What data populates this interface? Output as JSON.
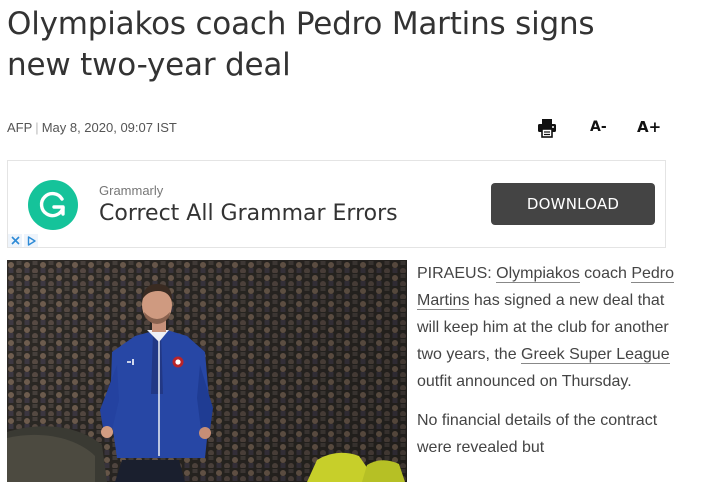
{
  "article": {
    "headline": "Olympiakos coach Pedro Martins signs new two-year deal",
    "source": "AFP",
    "date": "May 8, 2020, 09:07 IST"
  },
  "tools": {
    "print_icon": "printer-icon",
    "font_decrease": "A-",
    "font_increase": "A+"
  },
  "ad": {
    "brand": "Grammarly",
    "title": "Correct All Grammar Errors",
    "cta": "DOWNLOAD",
    "logo_icon": "grammarly-g-icon",
    "logo_color": "#15c39a",
    "button_color": "#444444"
  },
  "body": {
    "p1_lead": "PIRAEUS: ",
    "p1_link1": "Olympiakos",
    "p1_text1": " coach ",
    "p1_link2": "Pedro Martins",
    "p1_text2": " has signed a new deal that will keep him at the club for another two years, the ",
    "p1_link3": "Greek Super League",
    "p1_text3": " outfit announced on Thursday.",
    "p2": "No financial details of the contract were revealed but"
  }
}
